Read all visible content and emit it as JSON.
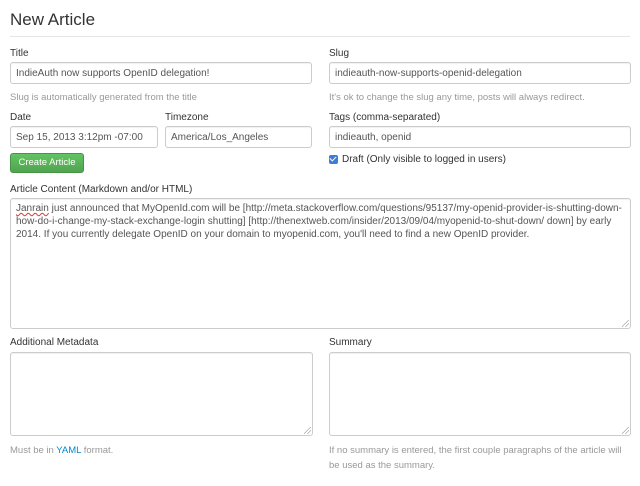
{
  "page": {
    "title": "New Article"
  },
  "title_field": {
    "label": "Title",
    "value": "IndieAuth now supports OpenID delegation!",
    "help": "Slug is automatically generated from the title"
  },
  "slug_field": {
    "label": "Slug",
    "value": "indieauth-now-supports-openid-delegation",
    "help": "It's ok to change the slug any time, posts will always redirect."
  },
  "date_field": {
    "label": "Date",
    "value": "Sep 15, 2013 3:12pm -07:00"
  },
  "timezone_field": {
    "label": "Timezone",
    "value": "America/Los_Angeles"
  },
  "tags_field": {
    "label": "Tags (comma-separated)",
    "value": "indieauth, openid"
  },
  "draft": {
    "label": "Draft (Only visible to logged in users)",
    "checked": true
  },
  "create_button": {
    "label": "Create Article"
  },
  "content_field": {
    "label": "Article Content (Markdown and/or HTML)",
    "first_word": "Janrain",
    "rest": " just announced that MyOpenId.com will be [http://meta.stackoverflow.com/questions/95137/my-openid-provider-is-shutting-down-how-do-i-change-my-stack-exchange-login shutting] [http://thenextweb.com/insider/2013/09/04/myopenid-to-shut-down/ down] by early 2014. If you currently delegate OpenID on your domain to myopenid.com, you'll need to find a new OpenID provider."
  },
  "metadata_field": {
    "label": "Additional Metadata",
    "value": "",
    "help_prefix": "Must be in ",
    "help_link": "YAML",
    "help_suffix": " format."
  },
  "summary_field": {
    "label": "Summary",
    "value": "",
    "help": "If no summary is entered, the first couple paragraphs of the article will be used as the summary."
  },
  "colors": {
    "accent_green": "#5bb75b",
    "link": "#0088cc",
    "help_text": "#999999",
    "checkbox": "#3b7dd8"
  }
}
